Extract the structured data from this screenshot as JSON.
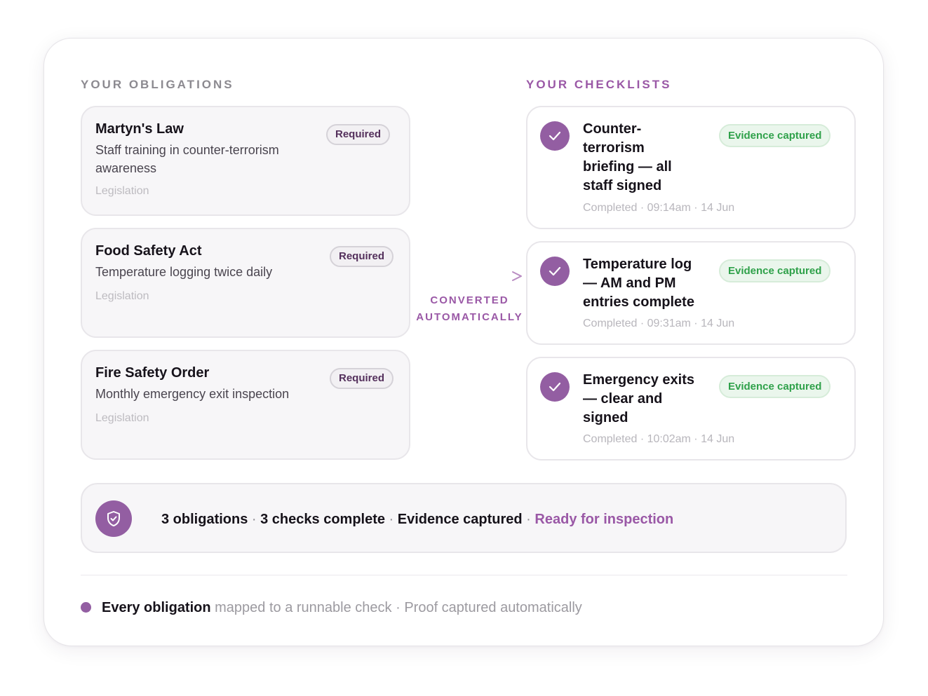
{
  "obligations_label": "YOUR OBLIGATIONS",
  "checklists_label": "YOUR CHECKLISTS",
  "obligations": [
    {
      "title": "Martyn's Law",
      "description": "Staff training in counter-terrorism awareness",
      "type": "Legislation",
      "badge": "Required"
    },
    {
      "title": "Food Safety Act",
      "description": "Temperature logging twice daily",
      "type": "Legislation",
      "badge": "Required"
    },
    {
      "title": "Fire Safety Order",
      "description": "Monthly emergency exit inspection",
      "type": "Legislation",
      "badge": "Required"
    }
  ],
  "checklists": [
    {
      "title": "Counter-terrorism briefing — all staff signed",
      "meta": "Completed · 09:14am · 14 Jun",
      "badge": "Evidence captured"
    },
    {
      "title": "Temperature log — AM and PM entries complete",
      "meta": "Completed · 09:31am · 14 Jun",
      "badge": "Evidence captured"
    },
    {
      "title": "Emergency exits — clear and signed",
      "meta": "Completed · 10:02am · 14 Jun",
      "badge": "Evidence captured"
    }
  ],
  "converted_label": "CONVERTED AUTOMATICALLY",
  "summary": {
    "obligations": "3 obligations",
    "checks": "3 checks complete",
    "evidence": "Evidence captured",
    "separator": " · ",
    "status": "Ready for inspection"
  },
  "footer": {
    "lead": "Every obligation",
    "rest": " mapped to a runnable check · Proof captured automatically"
  },
  "colors": {
    "accent": "#935ea2",
    "accent_text": "#9a58a6",
    "evidence_green": "#2fa14a",
    "required_text": "#54305c"
  },
  "icons": {
    "check": "check-icon",
    "shield": "shield-check-icon",
    "arrow": "arrow-right-icon"
  }
}
